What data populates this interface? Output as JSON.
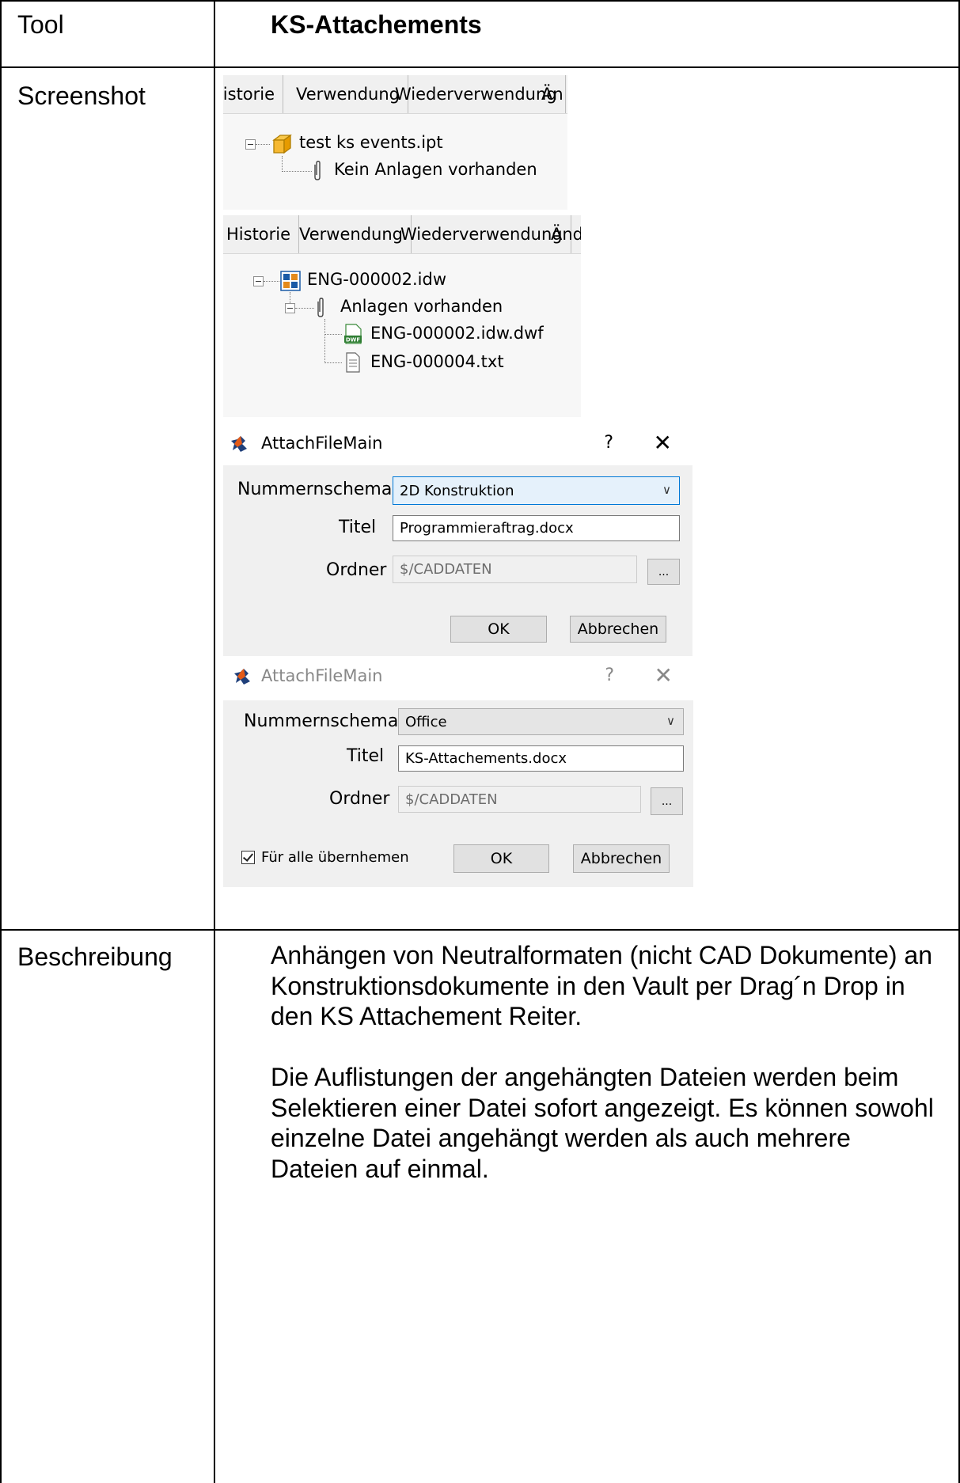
{
  "table": {
    "rows": [
      {
        "label": "Tool",
        "value": "KS-Attachements"
      },
      {
        "label": "Screenshot"
      },
      {
        "label": "Beschreibung"
      }
    ]
  },
  "screenshot1": {
    "tabs": [
      "Historie",
      "Verwendung",
      "Wiederverwendung",
      "Än"
    ],
    "tree": {
      "root_name": "test ks events.ipt",
      "child": "Kein Anlagen vorhanden"
    }
  },
  "screenshot2": {
    "tabs": [
      "Historie",
      "Verwendung",
      "Wiederverwendung",
      "Änd"
    ],
    "tree": {
      "root_name": "ENG-000002.idw",
      "group": "Anlagen vorhanden",
      "files": [
        "ENG-000002.idw.dwf",
        "ENG-000004.txt"
      ]
    }
  },
  "dialog1": {
    "title": "AttachFileMain",
    "help": "?",
    "close": "✕",
    "labels": {
      "scheme": "Nummernschema",
      "title": "Titel",
      "folder": "Ordner"
    },
    "scheme_value": "2D Konstruktion",
    "title_value": "Programmieraftrag.docx",
    "folder_value": "$/CADDATEN",
    "browse": "...",
    "ok": "OK",
    "cancel": "Abbrechen"
  },
  "dialog2": {
    "title": "AttachFileMain",
    "help": "?",
    "close": "✕",
    "labels": {
      "scheme": "Nummernschema",
      "title": "Titel",
      "folder": "Ordner"
    },
    "scheme_value": "Office",
    "title_value": "KS-Attachements.docx",
    "folder_value": "$/CADDATEN",
    "browse": "...",
    "checkbox_label": "Für alle übernhemen",
    "checkbox_checked": true,
    "ok": "OK",
    "cancel": "Abbrechen"
  },
  "description": [
    "Anhängen von Neutralformaten (nicht CAD Dokumente) an Konstruktionsdokumente in den Vault per Drag´n Drop in den KS Attachement Reiter.",
    "Die Auflistungen der angehängten Dateien werden beim Selektieren einer Datei sofort angezeigt. Es können sowohl einzelne Datei angehängt werden als auch mehrere Dateien auf einmal."
  ],
  "colors": {
    "border": "#000000",
    "dialog_bg": "#f0f0f0",
    "focus": "#0078d7",
    "tab_bg": "#f0f0f0"
  },
  "icons": [
    "part-icon",
    "paperclip-icon",
    "drawing-icon",
    "dwf-file-icon",
    "text-file-icon",
    "app-logo-icon"
  ]
}
